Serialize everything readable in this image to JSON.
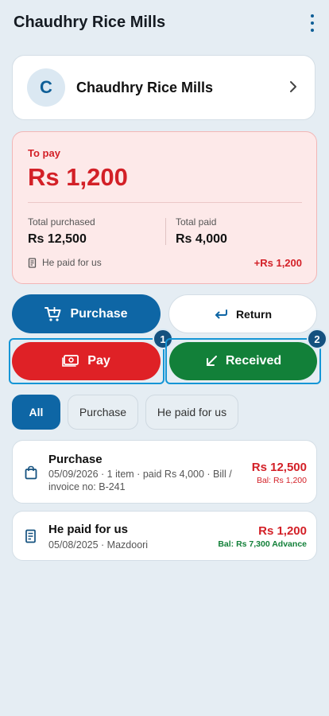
{
  "header": {
    "title": "Chaudhry Rice Mills"
  },
  "party": {
    "initial": "C",
    "name": "Chaudhry Rice Mills"
  },
  "summary": {
    "to_pay_label": "To pay",
    "to_pay_amount": "Rs 1,200",
    "total_purchased_label": "Total purchased",
    "total_purchased_value": "Rs 12,500",
    "total_paid_label": "Total paid",
    "total_paid_value": "Rs 4,000",
    "he_paid_label": "He paid for us",
    "he_paid_value": "+Rs 1,200"
  },
  "actions": {
    "purchase": "Purchase",
    "return": "Return",
    "pay": "Pay",
    "received": "Received",
    "badge_pay": "1",
    "badge_received": "2"
  },
  "filters": {
    "all": "All",
    "purchase": "Purchase",
    "he_paid": "He paid for us"
  },
  "transactions": [
    {
      "title": "Purchase",
      "subtitle": "05/09/2026 · 1 item · paid Rs 4,000 · Bill / invoice no: B-241",
      "amount": "Rs 12,500",
      "balance": "Bal: Rs 1,200",
      "icon": "shopping-bag-icon"
    },
    {
      "title": "He paid for us",
      "subtitle": "05/08/2025 · Mazdoori",
      "amount": "Rs 1,200",
      "balance": "Bal: Rs 7,300 Advance",
      "icon": "receipt-icon"
    }
  ],
  "colors": {
    "primary": "#0e66a5",
    "danger": "#df2126",
    "success": "#128039",
    "background": "#e5edf3"
  }
}
